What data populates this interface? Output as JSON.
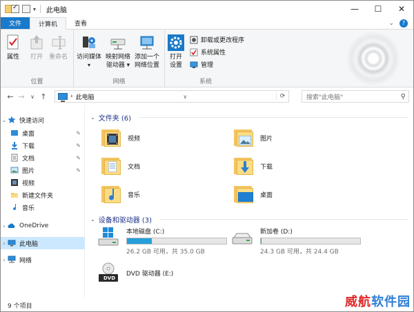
{
  "titlebar": {
    "title": "此电脑",
    "controls": {
      "minimize": "—",
      "maximize": "☐",
      "close": "✕"
    }
  },
  "tabs": [
    {
      "label": "文件"
    },
    {
      "label": "计算机"
    },
    {
      "label": "查看"
    }
  ],
  "tab_right": {
    "collapse": "⌄",
    "help": "?"
  },
  "ribbon": {
    "groups": {
      "location": {
        "label": "位置",
        "buttons": [
          {
            "label": "属性"
          },
          {
            "label": "打开"
          },
          {
            "label": "重命名"
          }
        ]
      },
      "network": {
        "label": "网络",
        "buttons": [
          {
            "label": "访问媒体"
          },
          {
            "label": "映射网络驱动器"
          },
          {
            "label": "添加一个网络位置"
          }
        ],
        "access_media": "访问媒体",
        "map_line1": "映射网络",
        "map_line2": "驱动器 ▾",
        "add_line1": "添加一个",
        "add_line2": "网络位置"
      },
      "system": {
        "label": "系统",
        "open_line1": "打开",
        "open_line2": "设置",
        "items": [
          {
            "label": "卸载或更改程序"
          },
          {
            "label": "系统属性"
          },
          {
            "label": "管理"
          }
        ]
      }
    }
  },
  "address": {
    "back": "←",
    "forward": "→",
    "recent": "∨",
    "up": "↑",
    "path_sep": "›",
    "path": "此电脑",
    "dropdown": "∨",
    "refresh": "⟳",
    "search_placeholder": "搜索\"此电脑\"",
    "search_icon": "⚲"
  },
  "navpane": {
    "quick_access": "快速访问",
    "quick_items": [
      {
        "label": "桌面",
        "pinned": true
      },
      {
        "label": "下载",
        "pinned": true
      },
      {
        "label": "文档",
        "pinned": true
      },
      {
        "label": "图片",
        "pinned": true
      },
      {
        "label": "视频",
        "pinned": false
      },
      {
        "label": "新建文件夹",
        "pinned": false
      },
      {
        "label": "音乐",
        "pinned": false
      }
    ],
    "onedrive": "OneDrive",
    "this_pc": "此电脑",
    "network": "网络",
    "pin_glyph": "📌"
  },
  "content": {
    "folders_header": "文件夹 (6)",
    "folders": [
      {
        "label": "视频",
        "icon": "video-folder-icon"
      },
      {
        "label": "图片",
        "icon": "pictures-folder-icon"
      },
      {
        "label": "文档",
        "icon": "documents-folder-icon"
      },
      {
        "label": "下载",
        "icon": "downloads-folder-icon"
      },
      {
        "label": "音乐",
        "icon": "music-folder-icon"
      },
      {
        "label": "桌面",
        "icon": "desktop-folder-icon"
      }
    ],
    "drives_header": "设备和驱动器 (3)",
    "drives": [
      {
        "label": "本地磁盘 (C:)",
        "usage": "26.2 GB 可用，共 35.0 GB",
        "used_fraction": 0.25
      },
      {
        "label": "新加卷 (D:)",
        "usage": "24.3 GB 可用，共 24.4 GB",
        "used_fraction": 0.01
      },
      {
        "label": "DVD 驱动器 (E:)",
        "dvd_badge": "DVD"
      }
    ]
  },
  "statusbar": {
    "count": "9 个项目"
  },
  "watermark": {
    "text1": "威航",
    "text2": "软件园"
  },
  "colors": {
    "accent": "#1979ca",
    "selection": "#cce8ff",
    "drive_bar": "#26a0da",
    "header": "#1e3287"
  }
}
